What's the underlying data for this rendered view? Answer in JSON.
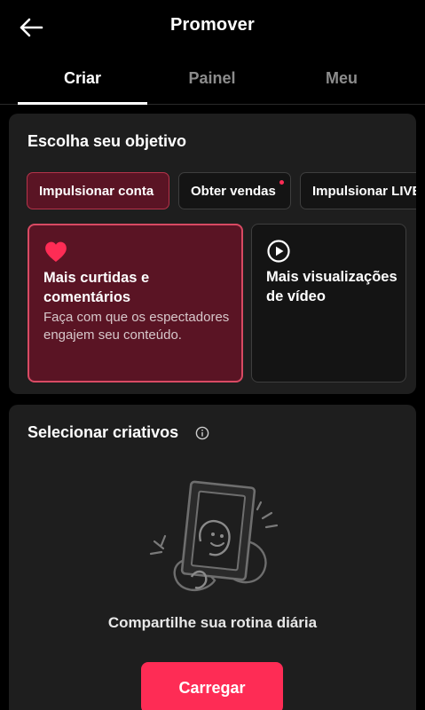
{
  "header": {
    "title": "Promover",
    "back_icon": "arrow-left-icon"
  },
  "tabs": [
    {
      "label": "Criar",
      "active": true
    },
    {
      "label": "Painel",
      "active": false
    },
    {
      "label": "Meu",
      "active": false
    }
  ],
  "objective": {
    "heading": "Escolha seu objetivo",
    "chips": [
      {
        "label": "Impulsionar conta",
        "selected": true,
        "has_dot": false
      },
      {
        "label": "Obter vendas",
        "selected": false,
        "has_dot": true
      },
      {
        "label": "Impulsionar LIVE",
        "selected": false,
        "has_dot": false
      }
    ],
    "options": [
      {
        "icon": "heart-icon",
        "title": "Mais curtidas e comentários",
        "description": "Faça com que os espectadores engajem seu conteúdo.",
        "selected": true
      },
      {
        "icon": "play-circle-icon",
        "title": "Mais visualizações de vídeo",
        "description": "",
        "selected": false
      }
    ]
  },
  "creatives": {
    "heading": "Selecionar criativos",
    "info_icon": "info-icon",
    "empty_text": "Compartilhe sua rotina diária",
    "upload_label": "Carregar"
  },
  "colors": {
    "background": "#000000",
    "card": "#1e1e1e",
    "accent": "#fe2c55",
    "selected_fill": "#5a1424",
    "selected_border": "#d94a63"
  }
}
